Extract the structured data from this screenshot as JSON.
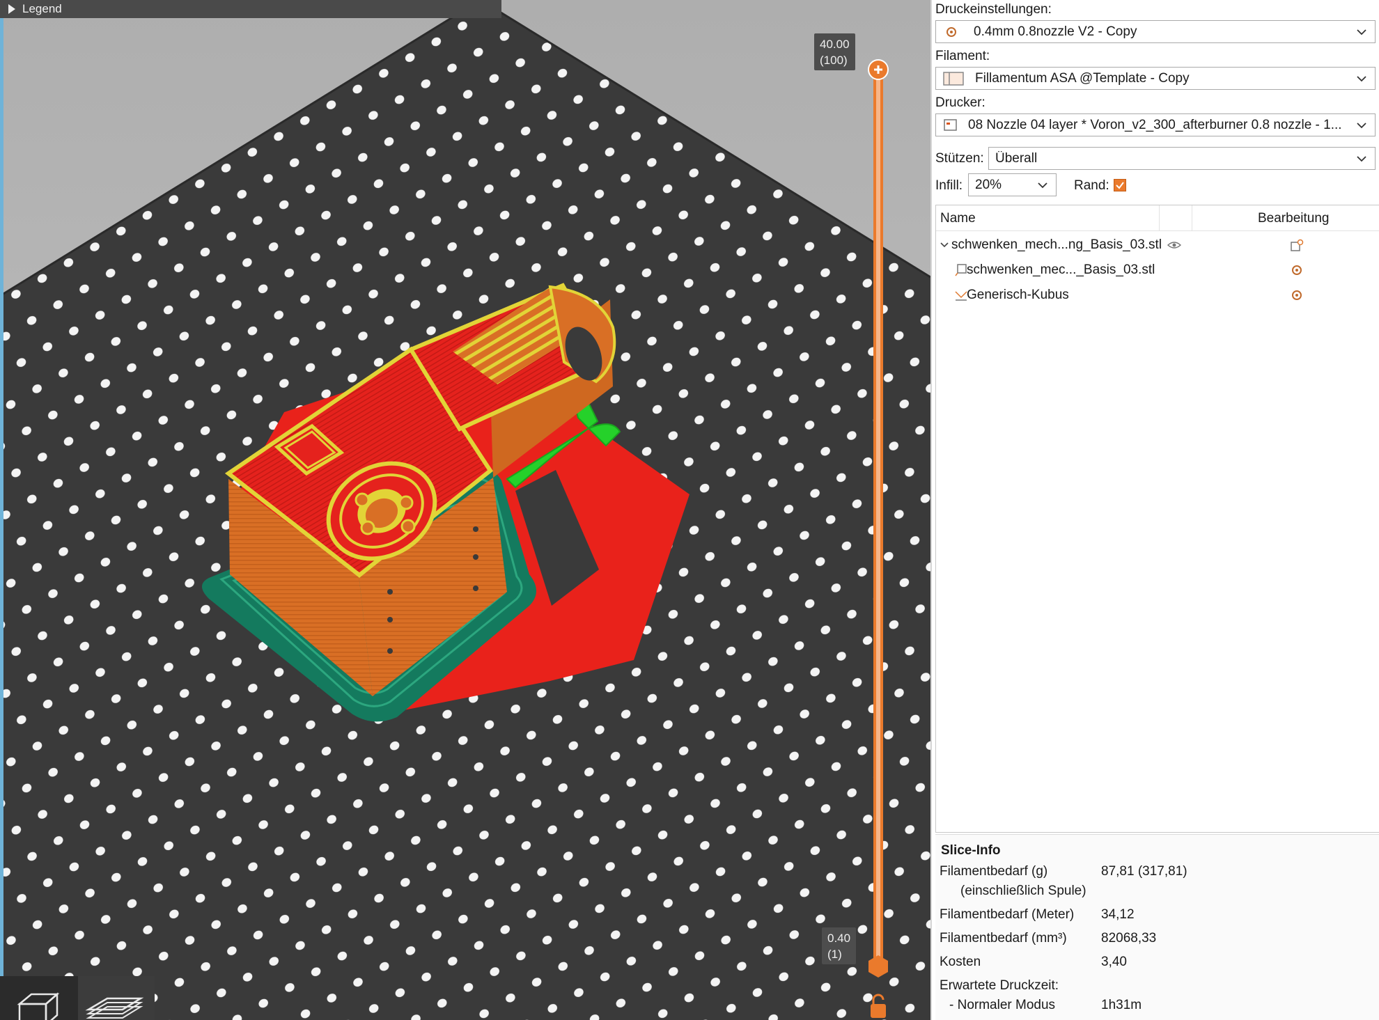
{
  "viewport": {
    "legend_label": "Legend",
    "layer_top": {
      "height": "40.00",
      "layer": "(100)"
    },
    "layer_bottom": {
      "height": "0.40",
      "layer": "(1)"
    },
    "slider_top_fraction": 1.0,
    "slider_bottom_fraction": 0.0,
    "colors": {
      "bed": "#3a3a3a",
      "wall": "#d96f25",
      "infill": "#e5221d",
      "perimeter": "#e2d437",
      "skirt": "#167f63",
      "support": "#22cc22",
      "accent": "#ea7a2c"
    },
    "view_buttons": [
      "cube-view-icon",
      "layers-view-icon"
    ]
  },
  "panel": {
    "print_settings": {
      "label": "Druckeinstellungen:",
      "value": "0.4mm 0.8nozzle V2 - Copy",
      "icon": "gear-icon"
    },
    "filament": {
      "label": "Filament:",
      "value": "Fillamentum ASA @Template - Copy",
      "icon": "spool-icon"
    },
    "printer": {
      "label": "Drucker:",
      "value": "08 Nozzle 04 layer * Voron_v2_300_afterburner 0.8 nozzle - 1...",
      "icon": "printer-icon"
    },
    "supports": {
      "label": "Stützen:",
      "value": "Überall"
    },
    "infill": {
      "label": "Infill:",
      "value": "20%"
    },
    "brim": {
      "label": "Rand:",
      "checked": true
    }
  },
  "objects": {
    "col_name": "Name",
    "col_edit": "Bearbeitung",
    "rows": [
      {
        "name": "schwenken_mech...ng_Basis_03.stl",
        "icon": "chevron-down-icon",
        "visibility": "eye-icon",
        "action": "edit-object-icon"
      },
      {
        "name": "schwenken_mec..._Basis_03.stl",
        "icon": "part-icon",
        "action": "gear-icon"
      },
      {
        "name": "Generisch-Kubus",
        "icon": "modifier-icon",
        "action": "gear-icon"
      }
    ]
  },
  "slice_info": {
    "title": "Slice-Info",
    "rows": [
      {
        "label": "Filamentbedarf (g)",
        "sub": "(einschließlich Spule)",
        "value": "87,81 (317,81)"
      },
      {
        "label": "Filamentbedarf (Meter)",
        "value": "34,12"
      },
      {
        "label": "Filamentbedarf (mm³)",
        "value": "82068,33"
      },
      {
        "label": "Kosten",
        "value": "3,40"
      },
      {
        "label": "Erwartete Druckzeit:",
        "value": ""
      },
      {
        "label": "- Normaler Modus",
        "value": "1h31m"
      }
    ]
  }
}
